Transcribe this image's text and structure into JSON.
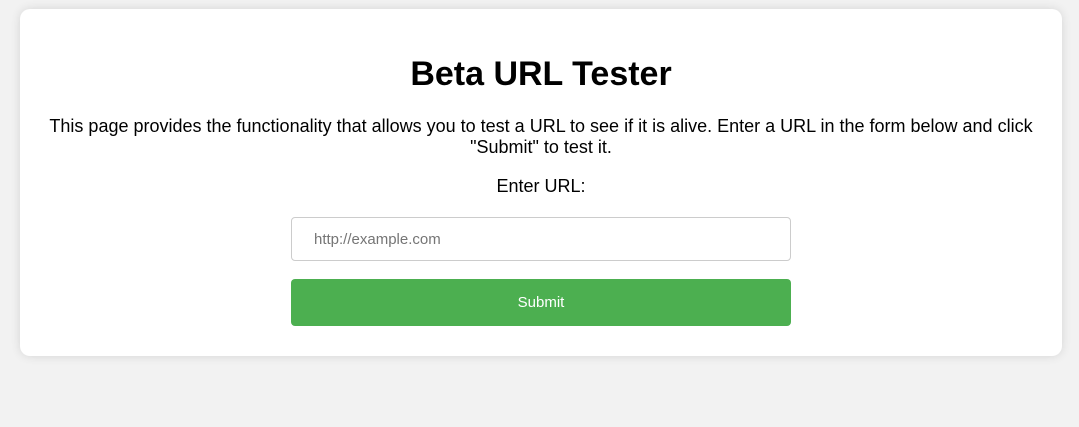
{
  "page": {
    "title": "Beta URL Tester",
    "description": "This page provides the functionality that allows you to test a URL to see if it is alive. Enter a URL in the form below and click \"Submit\" to test it.",
    "url_label": "Enter URL:"
  },
  "form": {
    "url_input": {
      "value": "",
      "placeholder": "http://example.com"
    },
    "submit_label": "Submit"
  },
  "colors": {
    "background": "#f2f2f2",
    "card": "#ffffff",
    "submit_button": "#4caf50",
    "submit_text": "#ffffff",
    "input_border": "#cccccc"
  }
}
